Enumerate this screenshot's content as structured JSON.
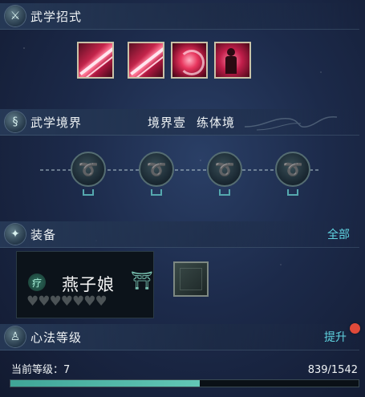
{
  "sections": {
    "martial_moves": {
      "title": "武学招式"
    },
    "martial_realm": {
      "title": "武学境界",
      "realm_stage": "境界壹",
      "realm_name": "练体境"
    },
    "equipment": {
      "title": "装备",
      "all_label": "全部"
    },
    "heart_method": {
      "title": "心法等级",
      "upgrade_label": "提升"
    }
  },
  "skills": [
    {
      "icon": "crimson-slash-icon"
    },
    {
      "icon": "crimson-slash-icon"
    },
    {
      "icon": "crimson-vortex-icon"
    },
    {
      "icon": "crimson-figure-icon"
    }
  ],
  "realm_nodes": [
    {
      "icon": "locked-swirl-icon"
    },
    {
      "icon": "locked-swirl-icon"
    },
    {
      "icon": "locked-swirl-icon"
    },
    {
      "icon": "locked-swirl-icon"
    }
  ],
  "equipped_item": {
    "name": "燕子娘",
    "left_badge": "疗",
    "hearts_total": 7,
    "hearts_filled": 0
  },
  "level": {
    "label": "当前等级：7",
    "progress_text": "839/1542",
    "current": 839,
    "max": 1542
  },
  "colors": {
    "accent_cyan": "#5fd3e0",
    "bar_fill": "#4fb6a6",
    "notify_dot": "#e04a3a"
  }
}
